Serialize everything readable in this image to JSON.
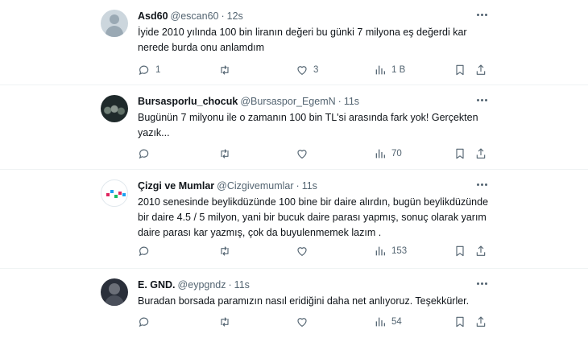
{
  "tweets": [
    {
      "name": "Asd60",
      "handle": "@escan60",
      "time": "12s",
      "text": "İyide 2010 yılında 100 bin liranın değeri bu günki 7 milyona eş değerdi kar nerede burda onu anlamdım",
      "replies": "1",
      "retweets": "",
      "likes": "3",
      "views": "1 B"
    },
    {
      "name": "Bursasporlu_chocuk",
      "handle": "@Bursaspor_EgemN",
      "time": "11s",
      "text": "Bugünün 7 milyonu ile o zamanın 100 bin TL'si arasında fark yok! Gerçekten yazık...",
      "replies": "",
      "retweets": "",
      "likes": "",
      "views": "70"
    },
    {
      "name": "Çizgi ve Mumlar",
      "handle": "@Cizgivemumlar",
      "time": "11s",
      "text": "2010 senesinde beylikdüzünde 100 bine bir daire alırdın, bugün beylikdüzünde bir daire 4.5 / 5 milyon, yani bir bucuk daire parası yapmış, sonuç olarak yarım daire parası kar yazmış, çok da buyulenmemek lazım .",
      "replies": "",
      "retweets": "",
      "likes": "",
      "views": "153"
    },
    {
      "name": "E. GND.",
      "handle": "@eypgndz",
      "time": "11s",
      "text": "Buradan borsada paramızın nasıl eridiğini daha net anlıyoruz. Teşekkürler.",
      "replies": "",
      "retweets": "",
      "likes": "",
      "views": "54"
    }
  ],
  "separator": "·"
}
